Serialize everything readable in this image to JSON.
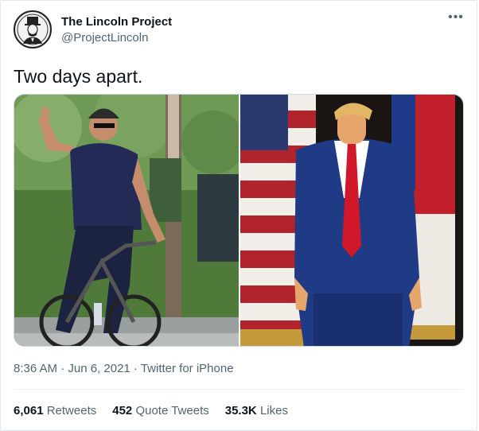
{
  "tweet": {
    "display_name": "The Lincoln Project",
    "handle": "@ProjectLincoln",
    "more_icon": "more-dots-icon",
    "text": "Two days apart.",
    "media": [
      {
        "id": "left",
        "description_icon": "photo"
      },
      {
        "id": "right",
        "description_icon": "photo"
      }
    ],
    "timestamp": "8:36 AM · Jun 6, 2021 · ",
    "source": "Twitter for iPhone",
    "stats": {
      "retweets_count": "6,061",
      "retweets_label": "Retweets",
      "quotes_count": "452",
      "quotes_label": "Quote Tweets",
      "likes_count": "35.3K",
      "likes_label": "Likes"
    }
  },
  "colors": {
    "text": "#0f1419",
    "secondary": "#536471",
    "border": "#e1e8ed"
  }
}
